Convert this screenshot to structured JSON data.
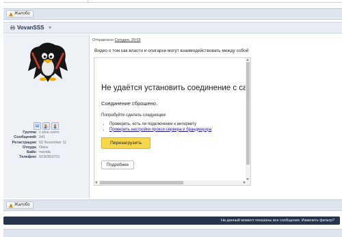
{
  "report_button_label": "Жалобо",
  "user": {
    "name": "VovanSSS",
    "info": [
      {
        "key": "Группа:",
        "value": "x-plus users"
      },
      {
        "key": "Сообщений:",
        "value": "341"
      },
      {
        "key": "Регистрация:",
        "value": "02 November 11"
      },
      {
        "key": "Откуда:",
        "value": "Омск"
      },
      {
        "key": "Байк:",
        "value": "merida"
      },
      {
        "key": "Телефон:",
        "value": "9230353701"
      }
    ]
  },
  "post": {
    "meta_prefix": "Отправлено",
    "meta_date": "Сегодня, 20:03",
    "message": "Видео о том как власти и олигархи могут взаимодействовать между собой"
  },
  "embed_error": {
    "title": "Не удаётся установить соединение с са",
    "subtitle": "Соединение сброшено.",
    "try_label": "Попробуйте сделать следующее:",
    "items": [
      "Проверить, есть ли подключение к интернету",
      "Проверить настройки прокси-сервера и брандмауэра"
    ],
    "reload_label": "Перезагрузить",
    "details_label": "Подробнее"
  },
  "bottom_report_label": "Жалобо",
  "notice_text": "На данный момент показаны все сообщения. Изменить фильтр?",
  "colors": {
    "notice_bg": "#26334d",
    "reload_bg": "#f6d64a",
    "link": "#1a0dab"
  }
}
